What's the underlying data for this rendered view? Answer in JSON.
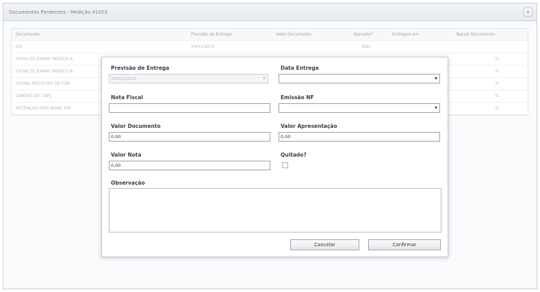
{
  "window": {
    "title": "Documentos Pendentes - Medição 41053",
    "close": "x"
  },
  "grid": {
    "columns": [
      "Documento",
      "Previsão de Entrega",
      "Valor Documento",
      "Baixado?",
      "Entregue em",
      "Baixar Documento"
    ],
    "rows": [
      {
        "documento": "ISS",
        "previsao": "24/01/2015",
        "valor": "",
        "baixado": "Não",
        "entregue": ""
      },
      {
        "documento": "FICHA DE EXAME MÉDICO A",
        "previsao": "",
        "valor": "",
        "baixado": "",
        "entregue": ""
      },
      {
        "documento": "FICHA DE EXAME MÉDICO A",
        "previsao": "",
        "valor": "",
        "baixado": "",
        "entregue": ""
      },
      {
        "documento": "FICHAS REGISTRO DE FUN",
        "previsao": "",
        "valor": "",
        "baixado": "",
        "entregue": ""
      },
      {
        "documento": "CARTÃO DO CNPJ",
        "previsao": "",
        "valor": "",
        "baixado": "",
        "entregue": ""
      },
      {
        "documento": "RETENÇÃO INSS NOVA TER",
        "previsao": "",
        "valor": "",
        "baixado": "",
        "entregue": ""
      }
    ]
  },
  "dialog": {
    "previsao_label": "Previsão de Entrega",
    "previsao_value": "24/01/2015",
    "data_entrega_label": "Data Entrega",
    "data_entrega_value": "",
    "nota_fiscal_label": "Nota Fiscal",
    "nota_fiscal_value": "",
    "emissao_label": "Emissão NF",
    "emissao_value": "",
    "valor_doc_label": "Valor Documento",
    "valor_doc_value": "0,00",
    "valor_apres_label": "Valor Apresentação",
    "valor_apres_value": "0,00",
    "valor_nota_label": "Valor Nota",
    "valor_nota_value": "0,00",
    "quitado_label": "Quitado?",
    "quitado_checked": false,
    "observacao_label": "Observação",
    "observacao_value": "",
    "cancel_label": "Cancelar",
    "confirm_label": "Confirmar"
  }
}
